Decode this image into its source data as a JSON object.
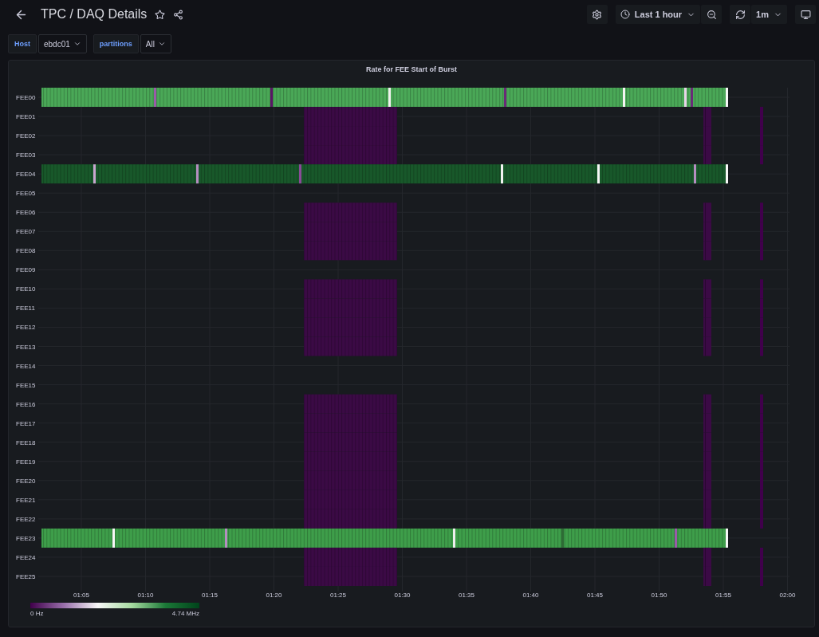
{
  "header": {
    "title": "TPC / DAQ Details"
  },
  "toolbar": {
    "time_range": "Last 1 hour",
    "refresh_interval": "1m"
  },
  "variables": [
    {
      "label": "Host",
      "value": "ebdc01"
    },
    {
      "label": "partitions",
      "value": "All"
    }
  ],
  "panel": {
    "title": "Rate for FEE Start of Burst",
    "rows": [
      {
        "label": "FEE00",
        "kind": "active",
        "color": "#4aa857"
      },
      {
        "label": "FEE01",
        "kind": "low"
      },
      {
        "label": "FEE02",
        "kind": "low"
      },
      {
        "label": "FEE03",
        "kind": "low"
      },
      {
        "label": "FEE04",
        "kind": "active",
        "color": "#18582a"
      },
      {
        "label": "FEE05",
        "kind": "empty"
      },
      {
        "label": "FEE06",
        "kind": "low"
      },
      {
        "label": "FEE07",
        "kind": "low"
      },
      {
        "label": "FEE08",
        "kind": "low"
      },
      {
        "label": "FEE09",
        "kind": "empty"
      },
      {
        "label": "FEE10",
        "kind": "low"
      },
      {
        "label": "FEE11",
        "kind": "low"
      },
      {
        "label": "FEE12",
        "kind": "low"
      },
      {
        "label": "FEE13",
        "kind": "low"
      },
      {
        "label": "FEE14",
        "kind": "empty"
      },
      {
        "label": "FEE15",
        "kind": "empty"
      },
      {
        "label": "FEE16",
        "kind": "low"
      },
      {
        "label": "FEE17",
        "kind": "low"
      },
      {
        "label": "FEE18",
        "kind": "low"
      },
      {
        "label": "FEE19",
        "kind": "low"
      },
      {
        "label": "FEE20",
        "kind": "low"
      },
      {
        "label": "FEE21",
        "kind": "low"
      },
      {
        "label": "FEE22",
        "kind": "low"
      },
      {
        "label": "FEE23",
        "kind": "active",
        "color": "#3e9e4a"
      },
      {
        "label": "FEE24",
        "kind": "low"
      },
      {
        "label": "FEE25",
        "kind": "low"
      }
    ],
    "x_ticks": [
      "01:05",
      "01:10",
      "01:15",
      "01:20",
      "01:25",
      "01:30",
      "01:35",
      "01:40",
      "01:45",
      "01:50",
      "01:55",
      "02:00"
    ],
    "legend": {
      "min": "0 Hz",
      "max": "4.74 MHz"
    }
  }
}
